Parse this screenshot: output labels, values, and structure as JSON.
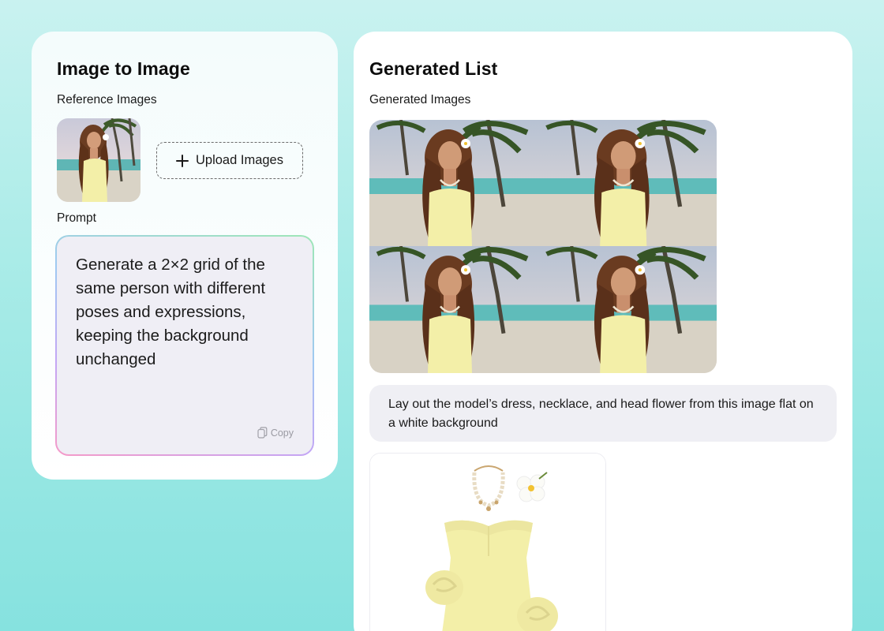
{
  "left_panel": {
    "title": "Image to Image",
    "reference_label": "Reference Images",
    "upload_label": "Upload Images",
    "prompt_label": "Prompt",
    "prompt_text": "Generate a 2×2 grid of the same person with different poses and expressions, keeping the background unchanged",
    "copy_label": "Copy"
  },
  "right_panel": {
    "title": "Generated List",
    "generated_label": "Generated Images",
    "message": "Lay out the model’s dress, necklace, and head flower from this image flat on a white background"
  },
  "icons": {
    "upload": "plus-icon",
    "copy": "copy-icon"
  },
  "colors": {
    "background_top": "#c9f2f0",
    "background_bottom": "#86e2df",
    "card": "#ffffff",
    "prompt_fill": "#efeef5",
    "bubble_fill": "#efeff4",
    "dress": "#f3efa8"
  }
}
